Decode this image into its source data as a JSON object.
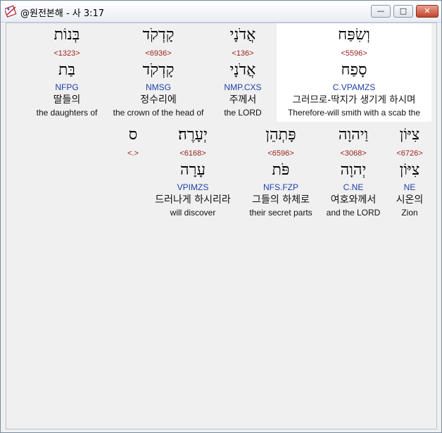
{
  "window": {
    "title": "@원전본해 - 사 3:17",
    "controls": {
      "minimize": "—",
      "maximize": "□",
      "close": "✕"
    }
  },
  "rows": [
    {
      "words": [
        {
          "heb": "בְּנוֹת",
          "num": "<1323>",
          "lemma": "בַּת",
          "parse": "NFPG",
          "kor": "딸들의",
          "eng": "the daughters of"
        },
        {
          "heb": "קָדְקֹד",
          "num": "<6936>",
          "lemma": "קָדְקֹד",
          "parse": "NMSG",
          "kor": "정수리에",
          "eng": "the crown of the head of"
        },
        {
          "heb": "אֲדֹנָי",
          "num": "<136>",
          "lemma": "אֲדֹנָי",
          "parse": "NMP.CXS",
          "kor": "주께서",
          "eng": "the LORD"
        },
        {
          "heb": "וְשִׂפַּח",
          "num": "<5596>",
          "lemma": "סָפַח",
          "parse": "C.VPAMZS",
          "kor": "그러므로-딱지가 생기게 하시며",
          "eng": "Therefore-will smith with a scab the"
        }
      ]
    },
    {
      "words": [
        {
          "heb": "ס",
          "num": "<.>",
          "lemma": "",
          "parse": "",
          "kor": "",
          "eng": ""
        },
        {
          "heb": "יְעָרֶה׃",
          "num": "<6168>",
          "lemma": "עָרָה",
          "parse": "VPIMZS",
          "kor": "드러나게 하시리라",
          "eng": "will discover"
        },
        {
          "heb": "פָּתְהֵן",
          "num": "<6596>",
          "lemma": "פֹּת",
          "parse": "NFS.FZP",
          "kor": "그들의 하체로",
          "eng": "their secret parts"
        },
        {
          "heb": "וַיהוָה",
          "num": "<3068>",
          "lemma": "יְהוָה",
          "parse": "C.NE",
          "kor": "여호와께서",
          "eng": "and the LORD"
        },
        {
          "heb": "צִיּוֹן",
          "num": "<6726>",
          "lemma": "צִיּוֹן",
          "parse": "NE",
          "kor": "시온의",
          "eng": "Zion"
        }
      ]
    }
  ]
}
